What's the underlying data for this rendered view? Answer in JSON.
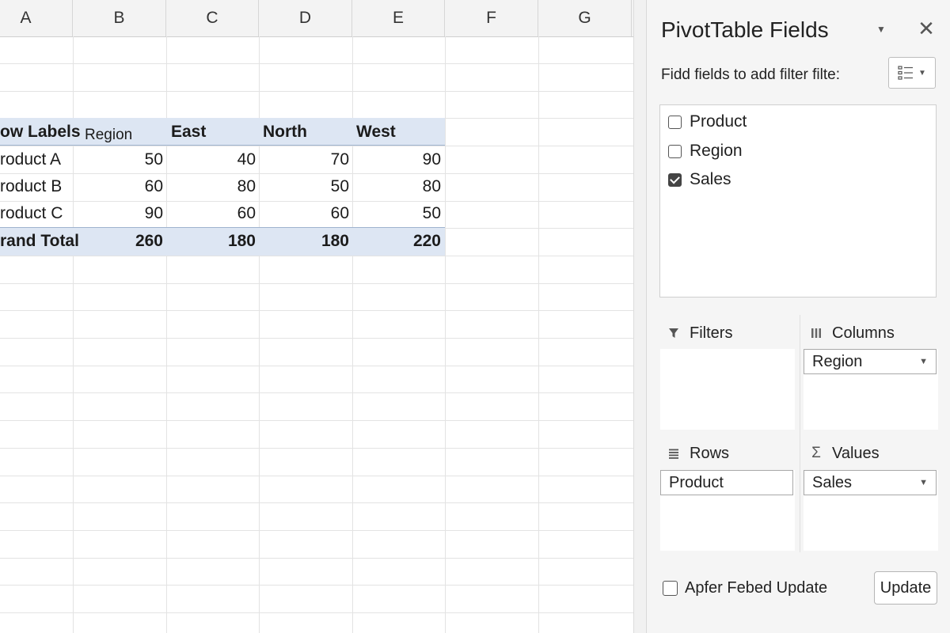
{
  "sheet": {
    "columns": [
      "A",
      "B",
      "C",
      "D",
      "E",
      "F",
      "G"
    ],
    "pivot": {
      "row_labels_header": "ow Labels",
      "region_label": "Region",
      "column_headers": [
        "East",
        "North",
        "West"
      ],
      "rows": [
        {
          "label": "roduct A",
          "values": [
            "50",
            "40",
            "70",
            "90"
          ]
        },
        {
          "label": "roduct B",
          "values": [
            "60",
            "80",
            "50",
            "80"
          ]
        },
        {
          "label": "roduct C",
          "values": [
            "90",
            "60",
            "60",
            "50"
          ]
        }
      ],
      "grand_total": {
        "label": "rand Total",
        "values": [
          "260",
          "180",
          "180",
          "220"
        ]
      }
    }
  },
  "pane": {
    "title": "PivotTable Fields",
    "subtitle": "Fidd fields to add filter filte:",
    "fields": [
      {
        "label": "Product",
        "checked": false
      },
      {
        "label": "Region",
        "checked": false
      },
      {
        "label": "Sales",
        "checked": true
      }
    ],
    "areas": {
      "filters": {
        "title": "Filters"
      },
      "columns": {
        "title": "Columns",
        "field": "Region"
      },
      "rows": {
        "title": "Rows",
        "field": "Product"
      },
      "values": {
        "title": "Values",
        "field": "Sales"
      }
    },
    "defer_label": "Apfer Febed Update",
    "update_label": "Update"
  },
  "colors": {
    "pivot_band": "#dde6f3",
    "pane_bg": "#f5f5f5"
  }
}
